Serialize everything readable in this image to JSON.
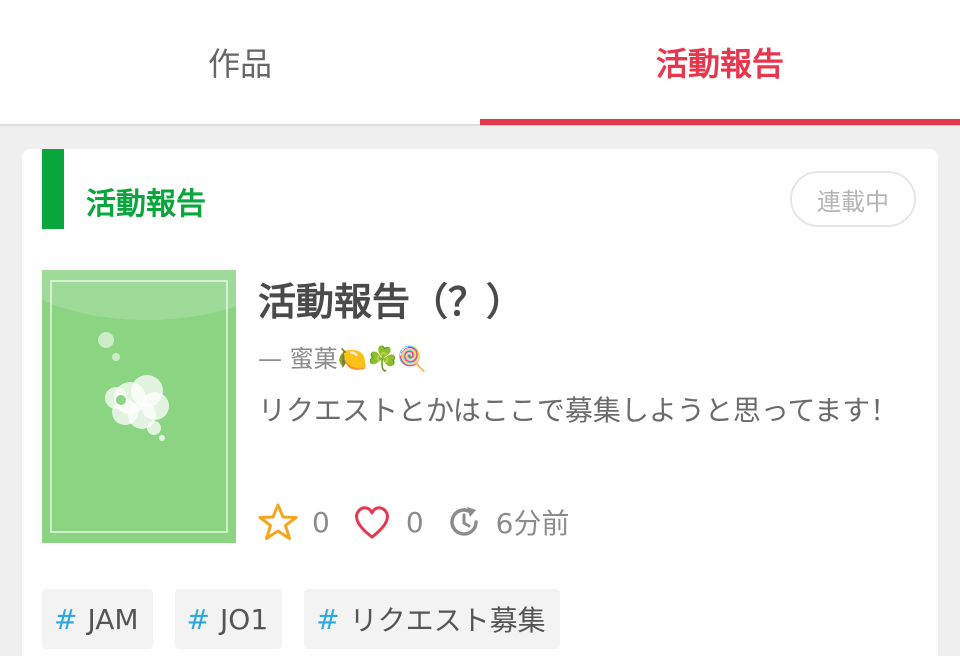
{
  "tabs": {
    "works_label": "作品",
    "report_label": "活動報告",
    "active": "活動報告",
    "active_color": "#e8364f"
  },
  "card": {
    "section_title": "活動報告",
    "section_color": "#0aa53c",
    "status_badge": "連載中",
    "work_title": "活動報告（？）",
    "author": "— 蜜菓🍋☘️🍭",
    "description": "リクエストとかはここで募集しようと思ってます！",
    "stats": {
      "stars": "0",
      "hearts": "0",
      "updated": "6分前"
    },
    "tags": [
      {
        "hash": "#",
        "label": "JAM"
      },
      {
        "hash": "#",
        "label": "JO1"
      },
      {
        "hash": "#",
        "label": "リクエスト募集"
      }
    ],
    "icons": {
      "star": "star-icon",
      "heart": "heart-icon",
      "update": "update-clock-icon"
    }
  }
}
